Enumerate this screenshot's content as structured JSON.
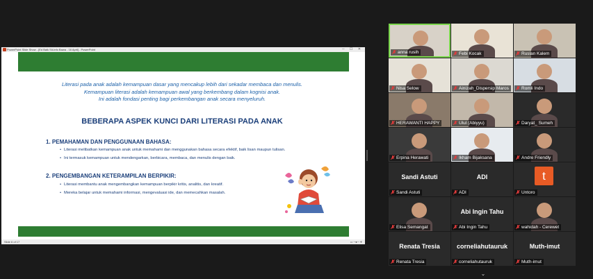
{
  "ppt": {
    "title": "PowerPoint Slide Show - [Ed Balk Sit-Info Bawa - 16 April] - PowerPoint",
    "status_slide": "Slide 6 of 17",
    "status_right": "",
    "intro_lines": [
      "Literasi pada anak adalah kemampuan dasar yang mencakup lebih dari sekadar membaca dan menulis.",
      "Kemampuan literasi adalah kemampuan awal yang berkembang dalam kognisi anak.",
      "Ini adalah fondasi penting bagi perkembangan anak secara menyeluruh."
    ],
    "heading": "BEBERAPA ASPEK KUNCI DARI LITERASI PADA ANAK",
    "sections": [
      {
        "title": "1. PEMAHAMAN DAN PENGGUNAAN BAHASA:",
        "bullets": [
          "Literasi melibatkan kemampuan anak untuk memahami dan menggunakan bahasa secara efektif, baik lisan maupun tulisan.",
          "Ini termasuk kemampuan untuk mendengarkan, berbicara, membaca, dan menulis dengan baik."
        ]
      },
      {
        "title": "2. PENGEMBANGAN KETERAMPILAN BERPIKIR:",
        "bullets": [
          "Literasi membantu anak mengembangkan kemampuan berpikir kritis, analitis, dan kreatif.",
          "Mereka belajar untuk memahami informasi, mengevaluasi ide, dan memecahkan masalah."
        ]
      }
    ]
  },
  "gallery": {
    "tiles": [
      {
        "name": "anna rusih",
        "type": "video",
        "bg": "#d8d2c8",
        "active": true
      },
      {
        "name": "Febi Kocak",
        "type": "video",
        "bg": "#e9e3d6"
      },
      {
        "name": "Ruslan Kalem",
        "type": "video",
        "bg": "#c9c2b4"
      },
      {
        "name": "Nisa Selow",
        "type": "video",
        "bg": "#e6e2d8"
      },
      {
        "name": "Ainizah_Dispersip Maros",
        "type": "video",
        "bg": "#dcd9d2"
      },
      {
        "name": "Romli Indo",
        "type": "video",
        "bg": "#d7dde3"
      },
      {
        "name": "HERAWANTI HAPPY",
        "type": "video",
        "bg": "#8a7a6a"
      },
      {
        "name": "Ulul (Abiyyu)",
        "type": "video",
        "bg": "#c2b8aa"
      },
      {
        "name": "Daryat_ Sumeh",
        "type": "video",
        "bg": "#2a2a2a"
      },
      {
        "name": "Erpina Herawati",
        "type": "video",
        "bg": "#3a3a3a"
      },
      {
        "name": "Ikham Bijaksana",
        "type": "video",
        "bg": "#e7ebef"
      },
      {
        "name": "Andre Friendly",
        "type": "video",
        "bg": "#2a2a2a"
      },
      {
        "name": "Sandi Astuti",
        "type": "name",
        "big": "Sandi Astuti"
      },
      {
        "name": "ADI",
        "type": "name",
        "big": "ADI"
      },
      {
        "name": "Untoro",
        "type": "letter",
        "letter": "t"
      },
      {
        "name": "Elisa Semangat",
        "type": "video",
        "bg": "#2a2a2a"
      },
      {
        "name": "Abi Ingin Tahu",
        "type": "name",
        "big": "Abi Ingin Tahu"
      },
      {
        "name": "wahidah - Cerewet",
        "type": "video",
        "bg": "#2a2a2a"
      },
      {
        "name": "Renata Tresia",
        "type": "name",
        "big": "Renata Tresia"
      },
      {
        "name": "corneliahutauruk",
        "type": "name",
        "big": "corneliahutauruk"
      },
      {
        "name": "Muth-imut",
        "type": "name",
        "big": "Muth-imut"
      }
    ],
    "colors": {
      "active_border": "#7ad64b",
      "muted_mic": "#e23b3b"
    }
  }
}
